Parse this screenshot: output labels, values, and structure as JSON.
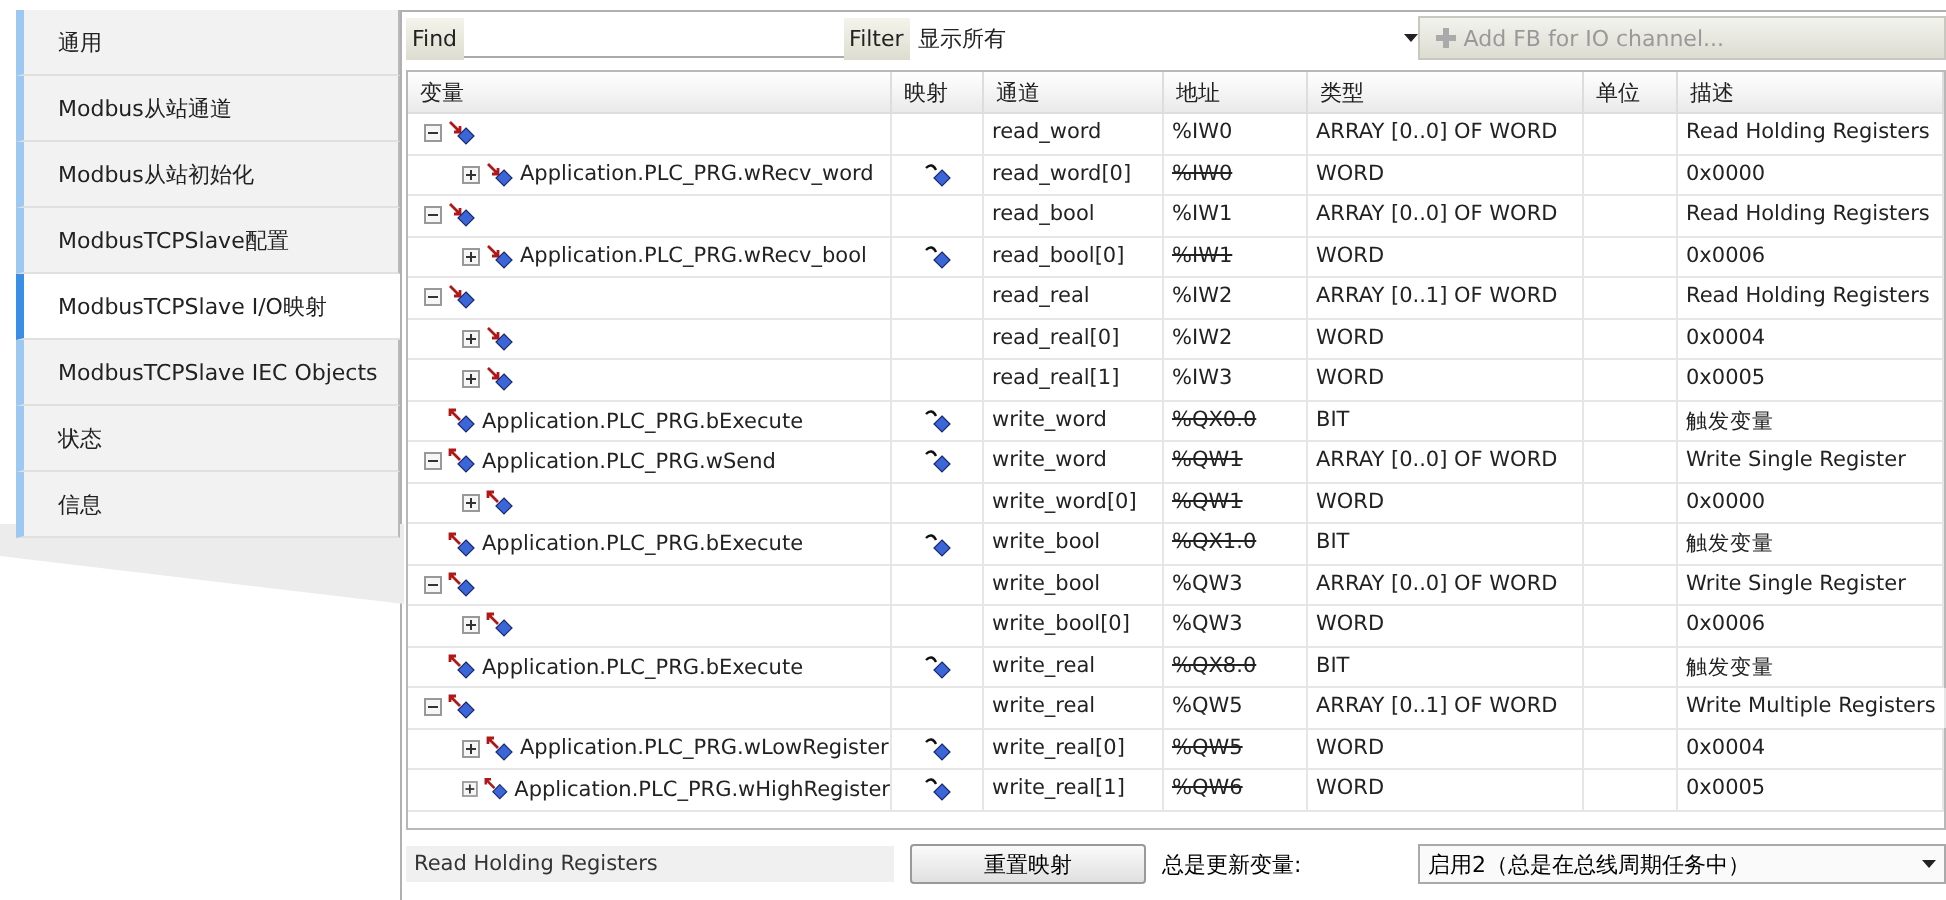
{
  "sidebar": {
    "tabs": [
      {
        "label": "通用",
        "selected": false
      },
      {
        "label": "Modbus从站通道",
        "selected": false
      },
      {
        "label": "Modbus从站初始化",
        "selected": false
      },
      {
        "label": "ModbusTCPSlave配置",
        "selected": false
      },
      {
        "label": "ModbusTCPSlave I/O映射",
        "selected": true
      },
      {
        "label": "ModbusTCPSlave IEC Objects",
        "selected": false
      },
      {
        "label": "状态",
        "selected": false
      },
      {
        "label": "信息",
        "selected": false
      }
    ]
  },
  "toolbar": {
    "find_label": "Find",
    "filter_label": "Filter",
    "filter_value": "显示所有",
    "add_fb": {
      "label": "Add FB for IO channel...",
      "disabled": true
    }
  },
  "table": {
    "columns": [
      "变量",
      "映射",
      "通道",
      "地址",
      "类型",
      "单位",
      "描述"
    ],
    "rows": [
      {
        "kind": "input",
        "expanded": true,
        "mapped": false,
        "channel": "read_word",
        "address": "%IW0",
        "crossed_out": false,
        "type": "ARRAY [0..0] OF WORD",
        "description": "Read Holding Registers",
        "children": [
          {
            "kind": "input",
            "expanded": false,
            "variable": "Application.PLC_PRG.wRecv_word",
            "mapped": true,
            "channel": "read_word[0]",
            "address": "%IW0",
            "crossed_out": true,
            "type": "WORD",
            "description": "0x0000"
          }
        ]
      },
      {
        "kind": "input",
        "expanded": true,
        "mapped": false,
        "channel": "read_bool",
        "address": "%IW1",
        "crossed_out": false,
        "type": "ARRAY [0..0] OF WORD",
        "description": "Read Holding Registers",
        "children": [
          {
            "kind": "input",
            "expanded": false,
            "variable": "Application.PLC_PRG.wRecv_bool",
            "mapped": true,
            "channel": "read_bool[0]",
            "address": "%IW1",
            "crossed_out": true,
            "type": "WORD",
            "description": "0x0006"
          }
        ]
      },
      {
        "kind": "input",
        "expanded": true,
        "mapped": false,
        "channel": "read_real",
        "address": "%IW2",
        "crossed_out": false,
        "type": "ARRAY [0..1] OF WORD",
        "description": "Read Holding Registers",
        "children": [
          {
            "kind": "input",
            "expanded": false,
            "mapped": false,
            "channel": "read_real[0]",
            "address": "%IW2",
            "crossed_out": false,
            "type": "WORD",
            "description": "0x0004"
          },
          {
            "kind": "input",
            "expanded": false,
            "mapped": false,
            "channel": "read_real[1]",
            "address": "%IW3",
            "crossed_out": false,
            "type": "WORD",
            "description": "0x0005"
          }
        ]
      },
      {
        "kind": "output",
        "variable": "Application.PLC_PRG.bExecute",
        "mapped": true,
        "channel": "write_word",
        "address": "%QX0.0",
        "crossed_out": true,
        "type": "BIT",
        "description": "触发变量"
      },
      {
        "kind": "output",
        "expanded": true,
        "variable": "Application.PLC_PRG.wSend",
        "mapped": true,
        "channel": "write_word",
        "address": "%QW1",
        "crossed_out": true,
        "type": "ARRAY [0..0] OF WORD",
        "description": "Write Single Register",
        "children": [
          {
            "kind": "output",
            "expanded": false,
            "mapped": false,
            "channel": "write_word[0]",
            "address": "%QW1",
            "crossed_out": true,
            "type": "WORD",
            "description": "0x0000"
          }
        ]
      },
      {
        "kind": "output",
        "variable": "Application.PLC_PRG.bExecute",
        "mapped": true,
        "channel": "write_bool",
        "address": "%QX1.0",
        "crossed_out": true,
        "type": "BIT",
        "description": "触发变量"
      },
      {
        "kind": "output",
        "expanded": true,
        "mapped": false,
        "channel": "write_bool",
        "address": "%QW3",
        "crossed_out": false,
        "type": "ARRAY [0..0] OF WORD",
        "description": "Write Single Register",
        "children": [
          {
            "kind": "output",
            "expanded": false,
            "mapped": false,
            "channel": "write_bool[0]",
            "address": "%QW3",
            "crossed_out": false,
            "type": "WORD",
            "description": "0x0006"
          }
        ]
      },
      {
        "kind": "output",
        "variable": "Application.PLC_PRG.bExecute",
        "mapped": true,
        "channel": "write_real",
        "address": "%QX8.0",
        "crossed_out": true,
        "type": "BIT",
        "description": "触发变量"
      },
      {
        "kind": "output",
        "expanded": true,
        "mapped": false,
        "channel": "write_real",
        "address": "%QW5",
        "crossed_out": false,
        "type": "ARRAY [0..1] OF WORD",
        "description": "Write Multiple Registers",
        "children": [
          {
            "kind": "output",
            "expanded": false,
            "variable": "Application.PLC_PRG.wLowRegister",
            "mapped": true,
            "channel": "write_real[0]",
            "address": "%QW5",
            "crossed_out": true,
            "type": "WORD",
            "description": "0x0004"
          },
          {
            "kind": "output",
            "expanded": false,
            "variable": "Application.PLC_PRG.wHighRegister",
            "mapped": true,
            "channel": "write_real[1]",
            "address": "%QW6",
            "crossed_out": true,
            "type": "WORD",
            "description": "0x0005"
          }
        ]
      }
    ]
  },
  "footer": {
    "description": "Read Holding Registers",
    "reset_button": "重置映射",
    "update_label": "总是更新变量:",
    "update_value": "启用2（总是在总线周期任务中）"
  }
}
